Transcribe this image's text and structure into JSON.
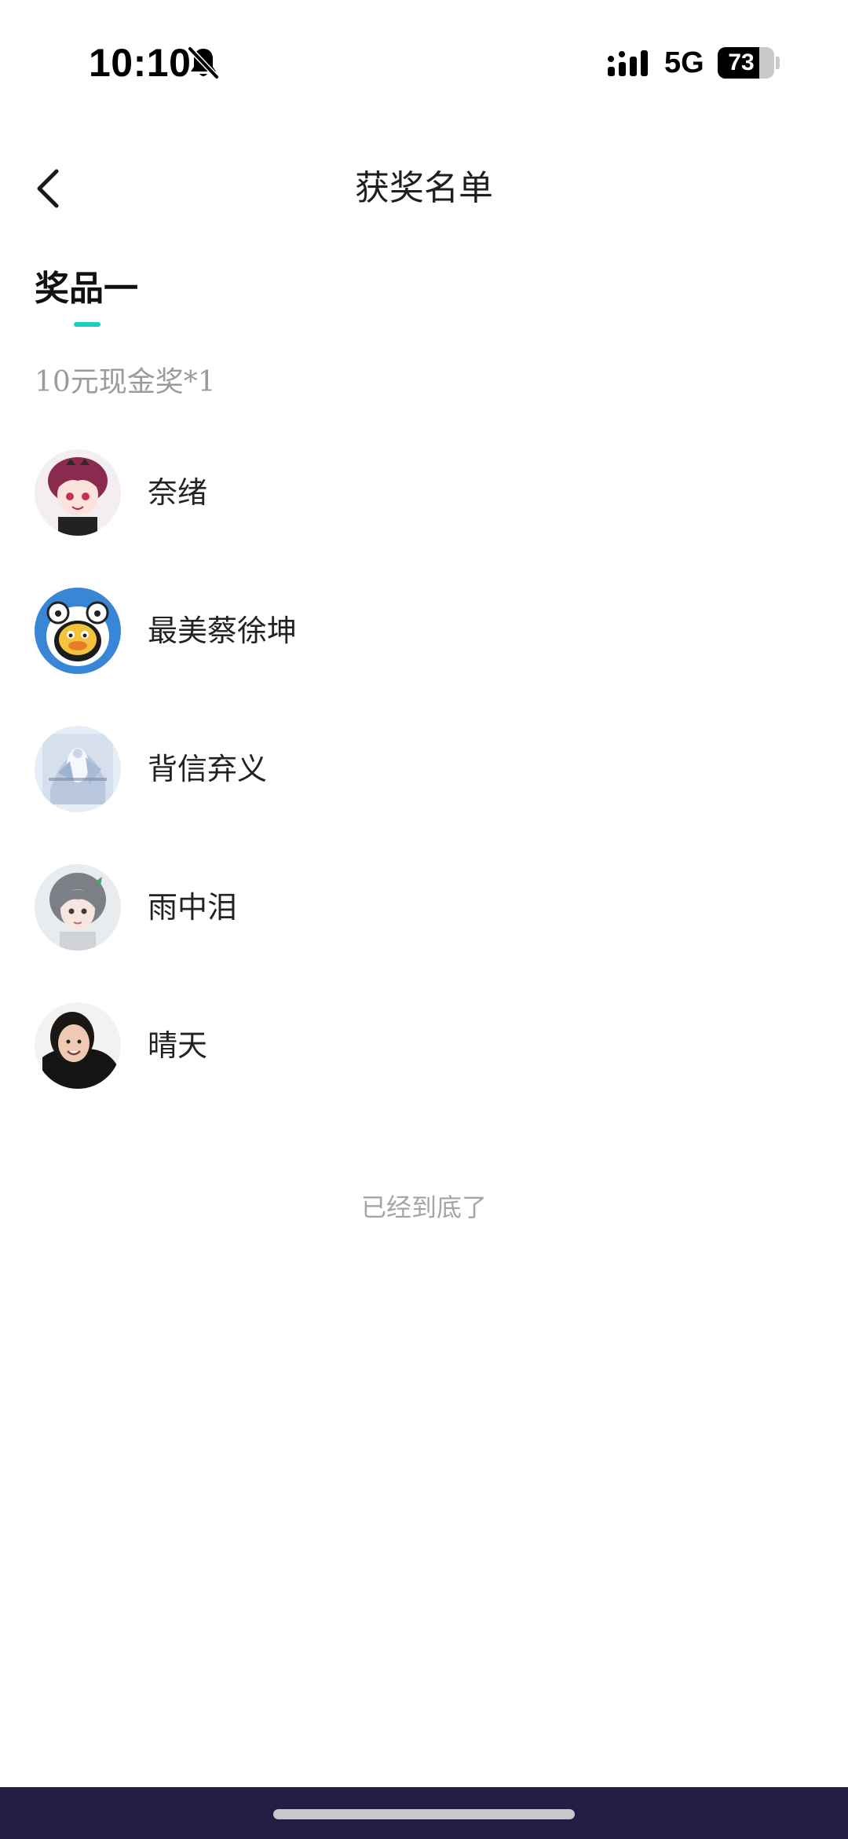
{
  "status_bar": {
    "time": "10:10",
    "network": "5G",
    "battery_level": "73",
    "battery_fraction": 0.73,
    "icons": [
      "bell-muted-icon",
      "signal-bars-icon",
      "battery-icon"
    ]
  },
  "header": {
    "title": "获奖名单",
    "back_icon": "chevron-left-icon"
  },
  "prize_tab": {
    "label": "奖品一",
    "indicator_color": "#1cd0b8"
  },
  "prize_description": "10元现金奖*1",
  "winners": [
    {
      "name": "奈绪",
      "avatar": "anime-girl-maroon-hair-avatar"
    },
    {
      "name": "最美蔡徐坤",
      "avatar": "cartoon-duck-avatar"
    },
    {
      "name": "背信弃义",
      "avatar": "pale-blue-artwork-avatar"
    },
    {
      "name": "雨中泪",
      "avatar": "anime-girl-silver-hair-avatar"
    },
    {
      "name": "晴天",
      "avatar": "person-photo-avatar"
    }
  ],
  "end_note": "已经到底了",
  "colors": {
    "accent": "#1cd0b8",
    "bottom_bar": "#231c45",
    "secondary_text": "#9b9b9b"
  }
}
